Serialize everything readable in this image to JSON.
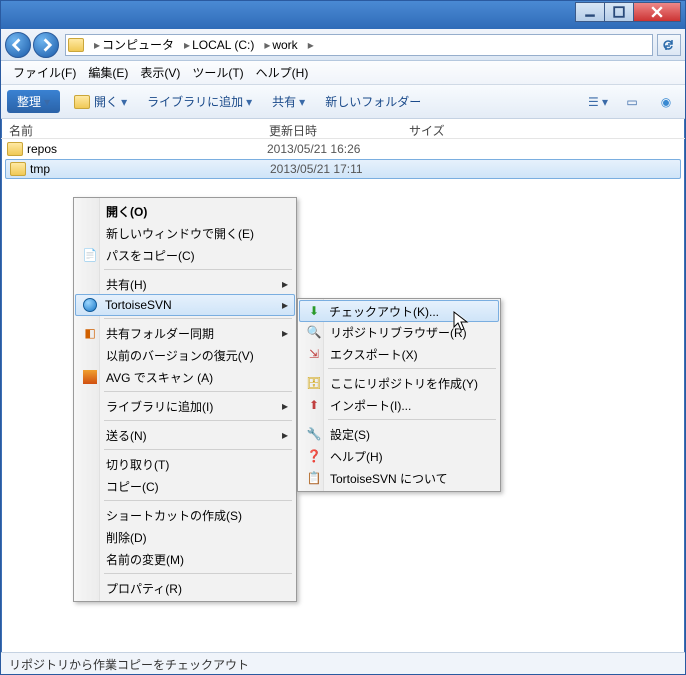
{
  "breadcrumb": {
    "root": "コンピュータ",
    "drive": "LOCAL (C:)",
    "folder": "work"
  },
  "menubar": {
    "file": "ファイル(F)",
    "edit": "編集(E)",
    "view": "表示(V)",
    "tools": "ツール(T)",
    "help": "ヘルプ(H)"
  },
  "toolbar": {
    "arrange": "整理",
    "open": "開く",
    "library": "ライブラリに追加",
    "share": "共有",
    "newfolder": "新しいフォルダー"
  },
  "columns": {
    "name": "名前",
    "date": "更新日時",
    "size": "サイズ"
  },
  "files": [
    {
      "name": "repos",
      "date": "2013/05/21 16:26"
    },
    {
      "name": "tmp",
      "date": "2013/05/21 17:11"
    }
  ],
  "statusbar": "リポジトリから作業コピーをチェックアウト",
  "ctx1": {
    "open": "開く(O)",
    "openNew": "新しいウィンドウで開く(E)",
    "copyPath": "パスをコピー(C)",
    "share": "共有(H)",
    "tortoise": "TortoiseSVN",
    "sharedFolderSync": "共有フォルダー同期",
    "restorePrev": "以前のバージョンの復元(V)",
    "avg": "AVG でスキャン (A)",
    "addLibrary": "ライブラリに追加(I)",
    "sendTo": "送る(N)",
    "cut": "切り取り(T)",
    "copy": "コピー(C)",
    "shortcut": "ショートカットの作成(S)",
    "delete": "削除(D)",
    "rename": "名前の変更(M)",
    "properties": "プロパティ(R)"
  },
  "ctx2": {
    "checkout": "チェックアウト(K)...",
    "repoBrowser": "リポジトリブラウザー(R)",
    "export": "エクスポート(X)",
    "createRepo": "ここにリポジトリを作成(Y)",
    "import": "インポート(I)...",
    "settings": "設定(S)",
    "help": "ヘルプ(H)",
    "about": "TortoiseSVN について"
  }
}
